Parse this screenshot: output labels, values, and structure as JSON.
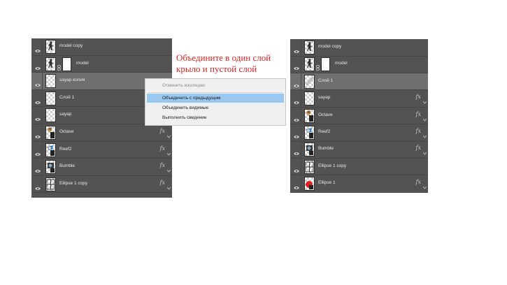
{
  "left_panel": {
    "layers": [
      {
        "name": "model copy",
        "thumb": "figure",
        "mask": false,
        "fx": false,
        "selected": false
      },
      {
        "name": "model",
        "thumb": "figure",
        "mask": true,
        "fx": false,
        "selected": false
      },
      {
        "name": "sayap копия",
        "thumb": "transparent",
        "mask": false,
        "fx": false,
        "selected": true
      },
      {
        "name": "Слой 1",
        "thumb": "transparent",
        "mask": false,
        "fx": false,
        "selected": false
      },
      {
        "name": "sayap",
        "thumb": "transparent",
        "mask": false,
        "fx": false,
        "selected": false
      },
      {
        "name": "Octave",
        "thumb": "character",
        "mask": false,
        "fx": true,
        "selected": false
      },
      {
        "name": "Reef2",
        "thumb": "character-blue",
        "mask": false,
        "fx": true,
        "selected": false
      },
      {
        "name": "Bumble",
        "thumb": "character-dark",
        "mask": false,
        "fx": true,
        "selected": false
      },
      {
        "name": "Ellipse 1 copy",
        "thumb": "grid",
        "mask": false,
        "fx": true,
        "selected": false
      }
    ]
  },
  "context_menu": {
    "items": [
      {
        "label": "Отменить изоляцию",
        "disabled": true,
        "highlighted": false
      },
      {
        "label": "Объединить с предыдущим",
        "disabled": false,
        "highlighted": true
      },
      {
        "label": "Объединить видимые",
        "disabled": false,
        "highlighted": false
      },
      {
        "label": "Выполнить сведение",
        "disabled": false,
        "highlighted": false
      }
    ]
  },
  "annotation": {
    "line1": "Объедините в один слой",
    "line2": "крыло и пустой слой",
    "color": "#e0201d"
  },
  "right_panel": {
    "layers": [
      {
        "name": "model copy",
        "thumb": "figure",
        "mask": false,
        "fx": false,
        "selected": false
      },
      {
        "name": "model",
        "thumb": "figure",
        "mask": true,
        "fx": false,
        "selected": false
      },
      {
        "name": "Слой 1",
        "thumb": "wing",
        "mask": false,
        "fx": false,
        "selected": true
      },
      {
        "name": "sayap",
        "thumb": "transparent",
        "mask": false,
        "fx": true,
        "selected": false
      },
      {
        "name": "Octave",
        "thumb": "character",
        "mask": false,
        "fx": true,
        "selected": false
      },
      {
        "name": "Reef2",
        "thumb": "character-blue",
        "mask": false,
        "fx": true,
        "selected": false
      },
      {
        "name": "Bumble",
        "thumb": "character-dark",
        "mask": false,
        "fx": true,
        "selected": false
      },
      {
        "name": "Ellipse 1 copy",
        "thumb": "grid",
        "mask": false,
        "fx": false,
        "selected": false
      },
      {
        "name": "Ellipse 1",
        "thumb": "red-ellipse",
        "mask": false,
        "fx": true,
        "selected": false
      }
    ]
  },
  "icons": {
    "visibility": "eye-icon",
    "link": "chain-icon",
    "effects": "fx-icon",
    "expand": "chevron-down-icon"
  },
  "effects_label": "fx"
}
